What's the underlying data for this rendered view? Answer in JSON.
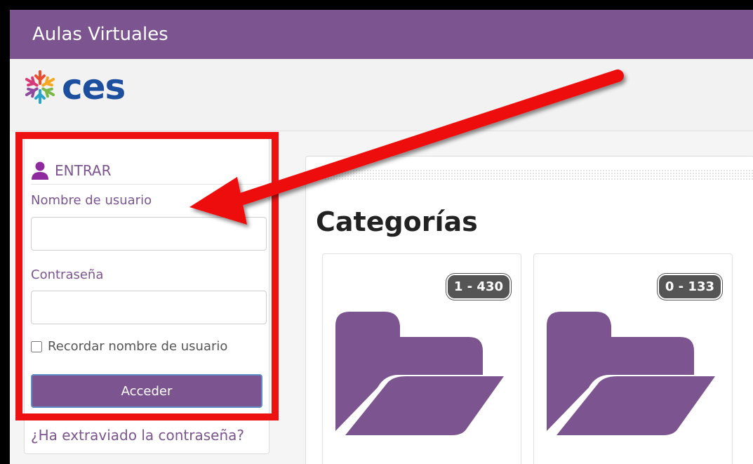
{
  "app": {
    "site_title": "Aulas Virtuales",
    "logo_text": "ces"
  },
  "login": {
    "header": "ENTRAR",
    "username_label": "Nombre de usuario",
    "username_value": "",
    "password_label": "Contraseña",
    "password_value": "",
    "remember_label": "Recordar nombre de usuario",
    "submit_label": "Acceder",
    "forgot_link": "¿Ha extraviado la contraseña?"
  },
  "main": {
    "heading": "Categorías",
    "categories": [
      {
        "count": "1 - 430",
        "icon": "folder-open-icon"
      },
      {
        "count": "0 - 133",
        "icon": "folder-open-icon"
      }
    ]
  },
  "annotation": {
    "highlight_color": "#ee1111",
    "arrow_color": "#ee1111"
  },
  "colors": {
    "brand": "#7c5490",
    "logo": "#1d4f9f",
    "badge": "#555555"
  },
  "icons": {
    "user": "user-icon",
    "logo_mark": "snowflake-logo-icon"
  }
}
